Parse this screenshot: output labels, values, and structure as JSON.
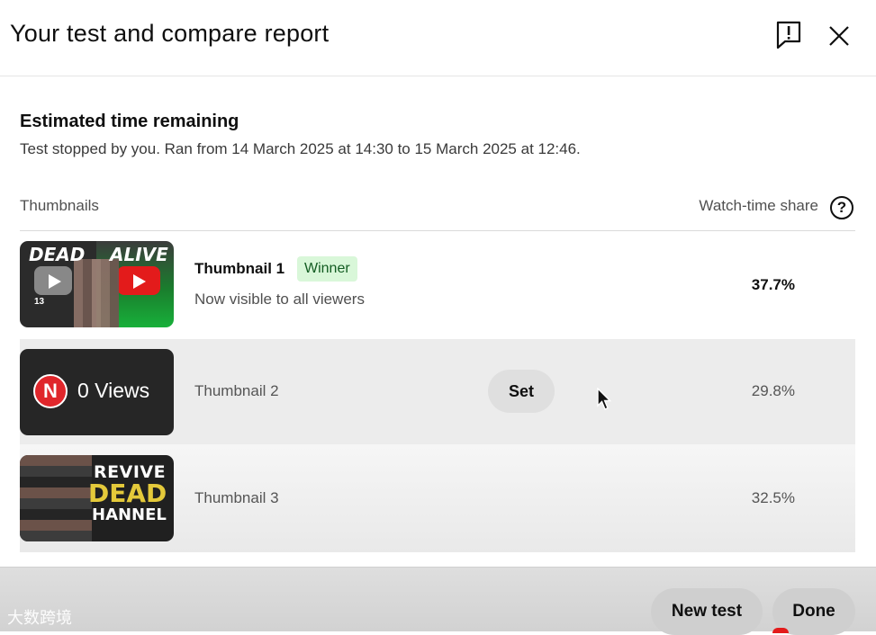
{
  "dialog": {
    "title": "Your test and compare report",
    "flag_icon": "feedback-flag-icon",
    "close_icon": "close-icon"
  },
  "estimate": {
    "heading": "Estimated time remaining",
    "status": "Test stopped by you. Ran from 14 March 2025 at 14:30 to 15 March 2025 at 12:46."
  },
  "table": {
    "col_thumbnails": "Thumbnails",
    "col_watch_share": "Watch-time share",
    "help_glyph": "?",
    "rows": [
      {
        "name": "Thumbnail 1",
        "badge": "Winner",
        "note": "Now visible to all viewers",
        "share": "37.7%",
        "thumb_text_left": "DEAD",
        "thumb_text_right": "ALIVE",
        "thumb_small": "13"
      },
      {
        "name": "Thumbnail 2",
        "action": "Set",
        "share": "29.8%",
        "badge_letter": "N",
        "thumb_text": "0 Views"
      },
      {
        "name": "Thumbnail 3",
        "share": "32.5%",
        "thumb_line1": "REVIVE",
        "thumb_line2": "DEAD",
        "thumb_line3": "HANNEL"
      }
    ]
  },
  "footer": {
    "new_test_label": "New test",
    "done_label": "Done",
    "watermark": "大数跨境"
  },
  "colors": {
    "winner_bg": "#d9f7d9",
    "winner_text": "#135c22",
    "accent_red": "#e31b1b",
    "thumbnail_gold": "#e4c93a"
  }
}
